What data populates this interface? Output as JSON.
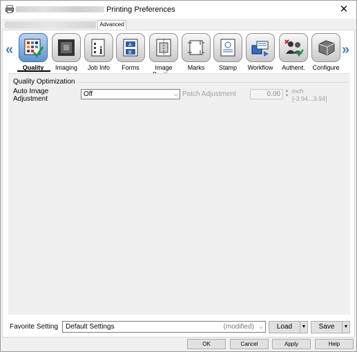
{
  "window": {
    "title": "Printing Preferences",
    "close_glyph": "✕"
  },
  "tabs": {
    "advanced_label": "Advanced"
  },
  "function_bar": {
    "items": [
      {
        "label": "Quality",
        "icon": "quality-grid-icon"
      },
      {
        "label": "Imaging",
        "icon": "imaging-icon"
      },
      {
        "label": "Job Info",
        "icon": "job-info-icon"
      },
      {
        "label": "Forms",
        "icon": "forms-icon"
      },
      {
        "label": "Image Position",
        "icon": "image-position-icon"
      },
      {
        "label": "Marks",
        "icon": "marks-icon"
      },
      {
        "label": "Stamp",
        "icon": "stamp-icon"
      },
      {
        "label": "Workflow",
        "icon": "workflow-icon"
      },
      {
        "label": "Authent.",
        "icon": "authentication-icon"
      },
      {
        "label": "Configure",
        "icon": "configure-icon"
      }
    ],
    "selected": "Quality",
    "left_arrow": "«",
    "right_arrow": "»"
  },
  "quality": {
    "group_title": "Quality Optimization",
    "auto_image_label": "Auto Image Adjustment",
    "auto_image_value": "Off",
    "patch_label": "Patch Adjustment",
    "patch_value": "0.00",
    "patch_unit": "inch",
    "patch_range": "[-3.94...3.94]"
  },
  "favorite": {
    "label": "Favorite Setting",
    "value": "Default Settings",
    "modified": "(modified)",
    "load_label": "Load",
    "save_label": "Save"
  },
  "buttons": {
    "ok": "OK",
    "cancel": "Cancel",
    "apply": "Apply",
    "help": "Help"
  },
  "colors": {
    "accent": "#3c7fc2",
    "selected_icon": "#5c94d4"
  }
}
